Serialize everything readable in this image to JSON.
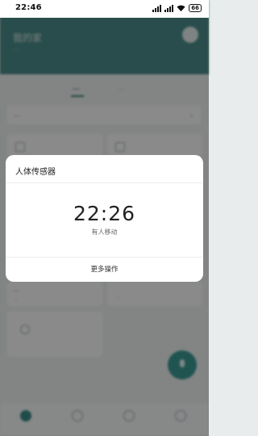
{
  "status_bar": {
    "time": "22:46",
    "battery": "66"
  },
  "background": {
    "home_title": "我的家",
    "home_subtitle": "...",
    "tabs": [
      "...",
      "..."
    ],
    "room_selector": "...",
    "cards": [
      {
        "title": "...",
        "subtitle": "..."
      },
      {
        "title": "...",
        "subtitle": "..."
      }
    ]
  },
  "dialog": {
    "title": "人体传感器",
    "time": "22:26",
    "status": "有人移动",
    "more_button": "更多操作"
  },
  "colors": {
    "header": "#4a8d8a",
    "accent": "#3a9a94",
    "dialog_bg": "#ffffff"
  }
}
